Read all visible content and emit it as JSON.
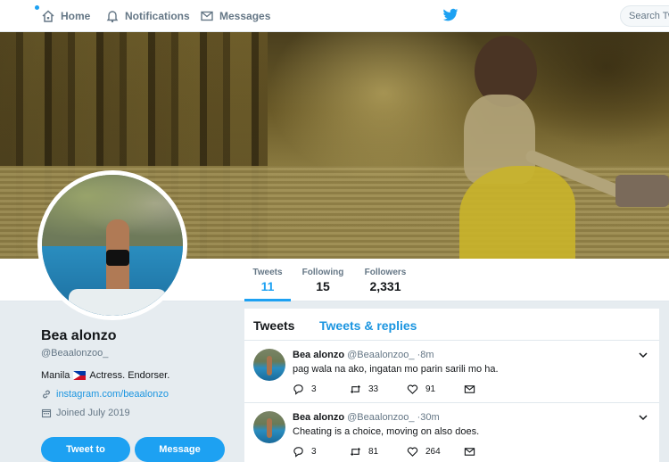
{
  "nav": {
    "home": "Home",
    "notifications": "Notifications",
    "messages": "Messages",
    "search_placeholder": "Search Twi",
    "accent": "#1da1f2"
  },
  "stats": {
    "tweets_label": "Tweets",
    "tweets_value": "11",
    "following_label": "Following",
    "following_value": "15",
    "followers_label": "Followers",
    "followers_value": "2,331"
  },
  "profile": {
    "name": "Bea alonzo",
    "handle": "@Beaalonzoo_",
    "bio_location": "Manila",
    "bio_text": "Actress. Endorser.",
    "link": "instagram.com/beaalonzo",
    "joined": "Joined July 2019",
    "tweet_to": "Tweet to",
    "message": "Message"
  },
  "timeline": {
    "tab_tweets": "Tweets",
    "tab_replies": "Tweets & replies",
    "tweets": [
      {
        "name": "Bea alonzo",
        "handle": "@Beaalonzoo_",
        "sep": "·",
        "time": "8m",
        "text": "pag wala na ako, ingatan mo parin sarili mo ha.",
        "replies": "3",
        "retweets": "33",
        "likes": "91"
      },
      {
        "name": "Bea alonzo",
        "handle": "@Beaalonzoo_",
        "sep": "·",
        "time": "30m",
        "text": "Cheating is a choice, moving on also does.",
        "replies": "3",
        "retweets": "81",
        "likes": "264"
      }
    ]
  },
  "icons": {
    "home": "home-icon",
    "notifications": "bell-icon",
    "messages": "envelope-icon",
    "logo": "twitter-bird-icon",
    "link": "link-icon",
    "calendar": "calendar-icon",
    "reply": "reply-icon",
    "retweet": "retweet-icon",
    "like": "heart-icon",
    "dm": "envelope-icon",
    "caret": "chevron-down-icon"
  }
}
